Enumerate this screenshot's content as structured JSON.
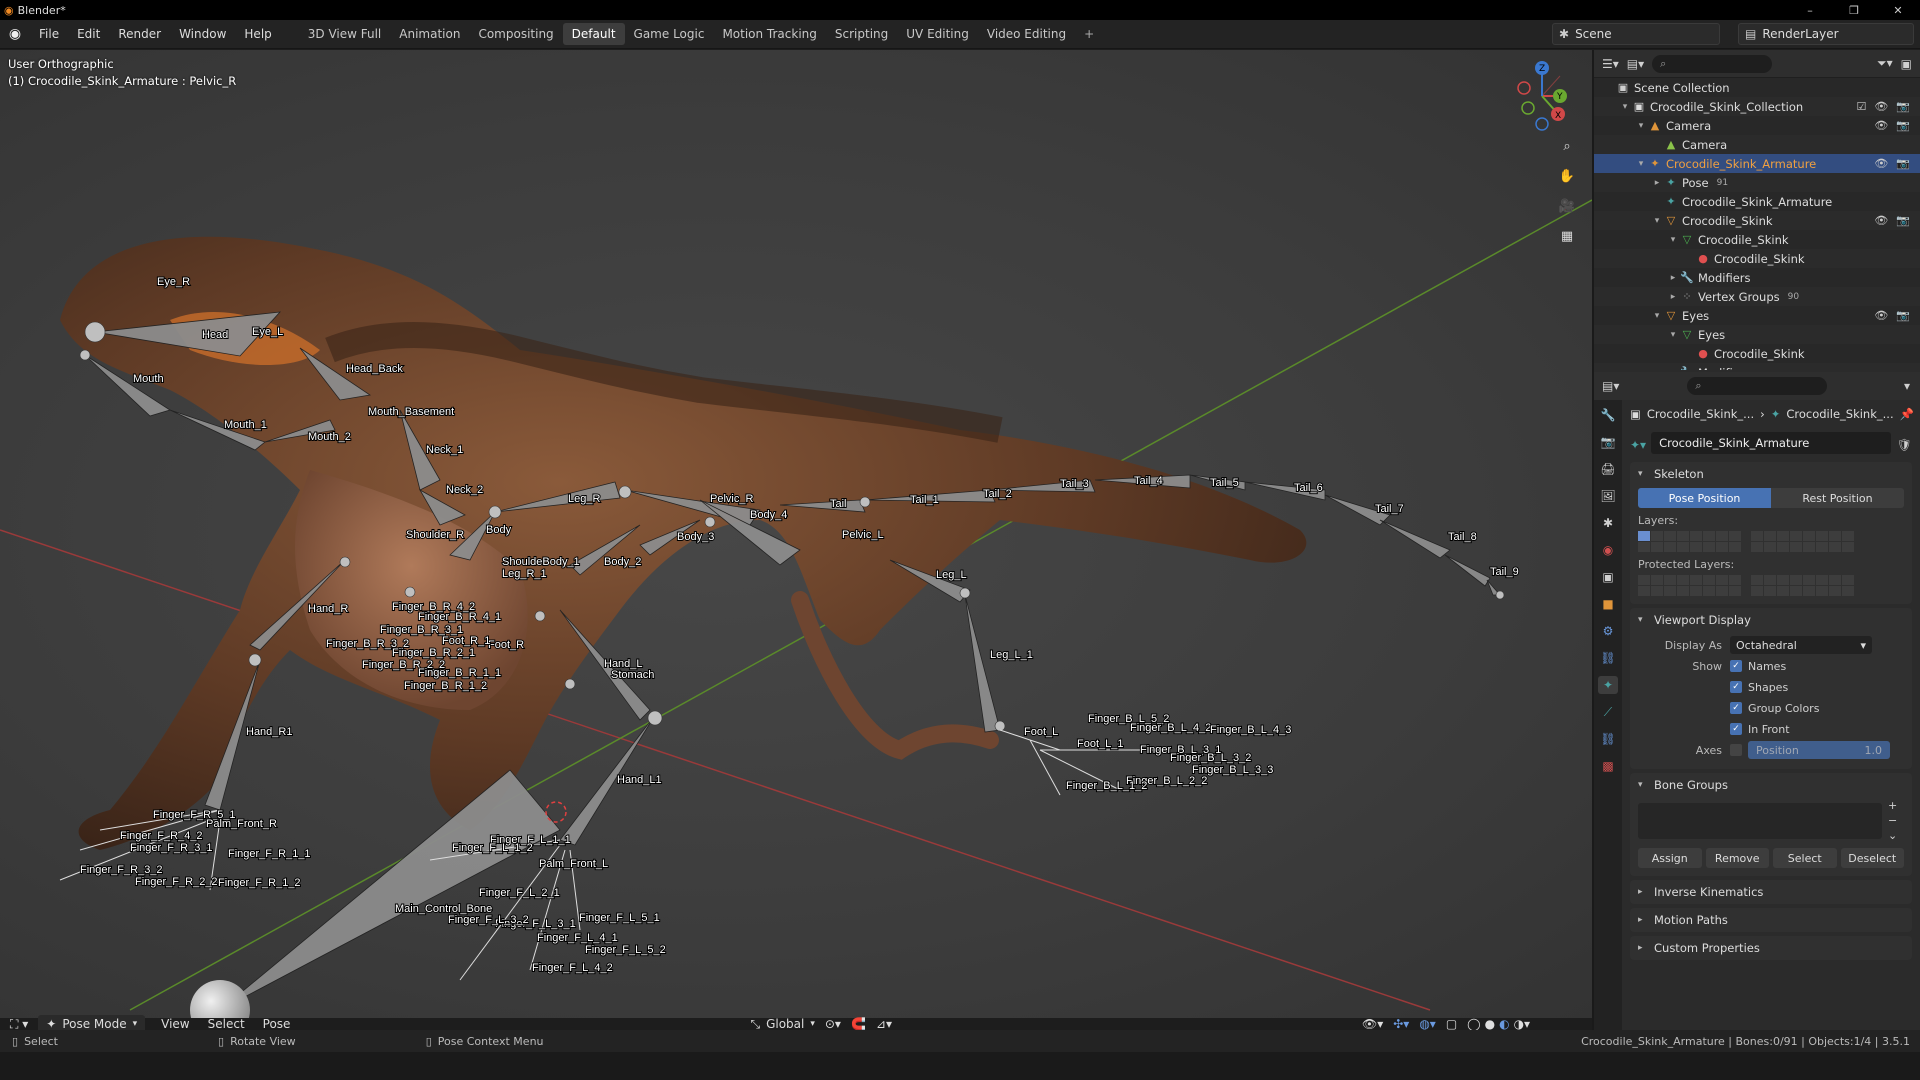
{
  "window": {
    "title": "Blender*",
    "min": "–",
    "max": "❐",
    "close": "✕"
  },
  "menu": [
    "File",
    "Edit",
    "Render",
    "Window",
    "Help"
  ],
  "workspaces": [
    "3D View Full",
    "Animation",
    "Compositing",
    "Default",
    "Game Logic",
    "Motion Tracking",
    "Scripting",
    "UV Editing",
    "Video Editing"
  ],
  "workspace_add": "+",
  "scene": {
    "label": "Scene",
    "renderlayer": "RenderLayer"
  },
  "viewport": {
    "view_name": "User Orthographic",
    "active": "(1) Crocodile_Skink_Armature : Pelvic_R",
    "axes": {
      "x": "X",
      "y": "Y",
      "z": "Z"
    },
    "bones": [
      "Eye_R",
      "Eye_L",
      "Head",
      "Head_Back",
      "Mouth",
      "Mouth_1",
      "Mouth_2",
      "Mouth_Basement",
      "Neck_1",
      "Neck_2",
      "Shoulder_R",
      "Body",
      "Leg_R",
      "Pelvic_R",
      "Body_4",
      "Tail",
      "Tail_1",
      "Tail_2",
      "Tail_3",
      "Tail_4",
      "Tail_5",
      "Tail_6",
      "Tail_7",
      "Tail_8",
      "Tail_9",
      "Body_3",
      "Body_2",
      "ShouldeBody_1",
      "Leg_R_1",
      "Pelvic_L",
      "Leg_L",
      "Leg_L_1",
      "Hand_R",
      "Hand_R1",
      "Hand_L",
      "Stomach",
      "Hand_L1",
      "Foot_R",
      "Foot_R_1",
      "Foot_L",
      "Foot_L_1",
      "Finger_B_R_4_2",
      "Finger_B_R_4_1",
      "Finger_B_R_3_1",
      "Finger_B_R_3_2",
      "Finger_B_R_2_1",
      "Finger_B_R_2_2",
      "Finger_B_R_1_1",
      "Finger_B_R_1_2",
      "Finger_B_L_5_2",
      "Finger_B_L_4_2",
      "Finger_B_L_4_3",
      "Finger_B_L_3_1",
      "Finger_B_L_3_2",
      "Finger_B_L_3_3",
      "Finger_B_L_2_2",
      "Finger_B_L_1_2",
      "Finger_F_R_5_1",
      "Finger_F_R_4_2",
      "Finger_F_R_3_1",
      "Finger_F_R_3_2",
      "Finger_F_R_2_2",
      "Finger_F_R_1_1",
      "Finger_F_R_1_2",
      "Palm_Front_R",
      "Finger_F_L_1_1",
      "Finger_F_L_1_2",
      "Palm_Front_L",
      "Finger_F_L_2_1",
      "Finger_F_L_3_1",
      "Finger_F_L_3_2",
      "Finger_F_L_4_1",
      "Finger_F_L_4_2",
      "Finger_F_L_5_1",
      "Finger_F_L_5_2",
      "Main_Control_Bone"
    ]
  },
  "viewport_header": {
    "mode": "Pose Mode",
    "menus": [
      "View",
      "Select",
      "Pose"
    ],
    "orientation": "Global"
  },
  "status": {
    "select": "Select",
    "rotate": "Rotate View",
    "context": "Pose Context Menu",
    "info": "Crocodile_Skink_Armature | Bones:0/91 | Objects:1/4 | 3.5.1"
  },
  "outliner": {
    "rows": [
      {
        "indent": 0,
        "label": "Scene Collection",
        "icon": "▣",
        "color": "#cfcfcf"
      },
      {
        "indent": 1,
        "label": "Crocodile_Skink_Collection",
        "icon": "▣",
        "color": "#ddd",
        "tri": "▾",
        "check": true
      },
      {
        "indent": 2,
        "label": "Camera",
        "icon": "▲",
        "color": "#e0953a",
        "tri": "▾",
        "eye": true
      },
      {
        "indent": 3,
        "label": "Camera",
        "icon": "▲",
        "color": "#8bc34a"
      },
      {
        "indent": 2,
        "label": "Crocodile_Skink_Armature",
        "icon": "✦",
        "color": "#e0953a",
        "tri": "▾",
        "eye": true,
        "sel": true
      },
      {
        "indent": 3,
        "label": "Pose",
        "icon": "✦",
        "color": "#4aa3a3",
        "tri": "▸",
        "extra": "91"
      },
      {
        "indent": 3,
        "label": "Crocodile_Skink_Armature",
        "icon": "✦",
        "color": "#4aa3a3"
      },
      {
        "indent": 3,
        "label": "Crocodile_Skink",
        "icon": "▽",
        "color": "#e0953a",
        "tri": "▾",
        "eye": true
      },
      {
        "indent": 4,
        "label": "Crocodile_Skink",
        "icon": "▽",
        "color": "#4caf50",
        "tri": "▾"
      },
      {
        "indent": 5,
        "label": "Crocodile_Skink",
        "icon": "●",
        "color": "#e05050"
      },
      {
        "indent": 4,
        "label": "Modifiers",
        "icon": "🔧",
        "color": "#6a8fd0",
        "tri": "▸"
      },
      {
        "indent": 4,
        "label": "Vertex Groups",
        "icon": "⁘",
        "color": "#aaa",
        "tri": "▸",
        "extra": "90"
      },
      {
        "indent": 3,
        "label": "Eyes",
        "icon": "▽",
        "color": "#e0953a",
        "tri": "▾",
        "eye": true
      },
      {
        "indent": 4,
        "label": "Eyes",
        "icon": "▽",
        "color": "#4caf50",
        "tri": "▾"
      },
      {
        "indent": 5,
        "label": "Crocodile_Skink",
        "icon": "●",
        "color": "#e05050"
      },
      {
        "indent": 4,
        "label": "Modifiers",
        "icon": "🔧",
        "color": "#6a8fd0",
        "tri": "▸"
      }
    ]
  },
  "properties": {
    "crumb1": "Crocodile_Skink_...",
    "crumb2": "Crocodile_Skink_...",
    "name": "Crocodile_Skink_Armature",
    "skeleton": {
      "title": "Skeleton",
      "pose": "Pose Position",
      "rest": "Rest Position",
      "layers": "Layers:",
      "protected": "Protected Layers:"
    },
    "viewport_display": {
      "title": "Viewport Display",
      "display_as_label": "Display As",
      "display_as": "Octahedral",
      "show": "Show",
      "names": "Names",
      "shapes": "Shapes",
      "group_colors": "Group Colors",
      "in_front": "In Front",
      "axes": "Axes",
      "position": "Position",
      "position_val": "1.0"
    },
    "bone_groups": {
      "title": "Bone Groups",
      "assign": "Assign",
      "remove": "Remove",
      "select": "Select",
      "deselect": "Deselect"
    },
    "panels": [
      "Inverse Kinematics",
      "Motion Paths",
      "Custom Properties"
    ]
  }
}
